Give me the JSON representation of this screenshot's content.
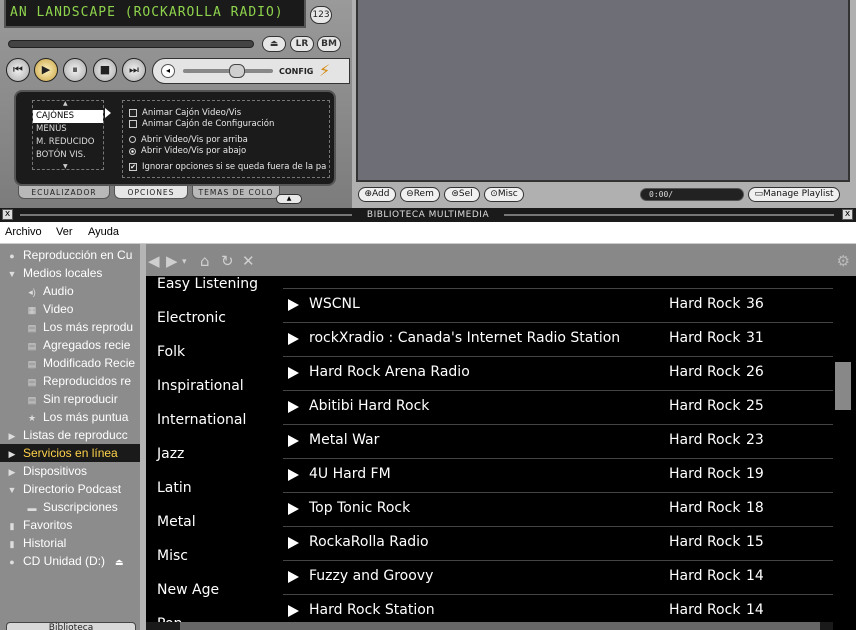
{
  "player": {
    "lcd_text": "AN LANDSCAPE (ROCKAROLLA RADIO)",
    "badge": "123",
    "shade_button": "⏏",
    "lr_button": "LR",
    "bm_button": "BM",
    "config_label": "CONFIG",
    "options": {
      "menu": [
        "CAJÓNES",
        "MENÚS",
        "M. REDUCIDO",
        "BOTÓN VIS."
      ],
      "checkbox_anim_video": "Animar Cajón Video/Vis",
      "checkbox_anim_config": "Animar Cajón de Configuración",
      "radio_open_top": "Abrir Video/Vis por arriba",
      "radio_open_bottom": "Abrir Video/Vis por abajo",
      "checkbox_ignore": "Ignorar opciones si se queda fuera de la pa"
    },
    "tabs": {
      "equalizer": "ECUALIZADOR",
      "options": "OPCIONES",
      "themes": "TEMAS DE COLO"
    }
  },
  "playlist": {
    "add": "Add",
    "rem": "Rem",
    "sel": "Sel",
    "misc": "Misc",
    "time": "0:00/",
    "manage": "Manage Playlist"
  },
  "library": {
    "title": "BIBLIOTECA MULTIMEDIA",
    "menu": {
      "archivo": "Archivo",
      "ver": "Ver",
      "ayuda": "Ayuda"
    },
    "tree": [
      {
        "label": "Reproducción en Cu",
        "icon": "●",
        "indent": 0,
        "selected": false
      },
      {
        "label": "Medios locales",
        "icon": "▼",
        "indent": 0,
        "selected": false
      },
      {
        "label": "Audio",
        "icon": "◂)",
        "indent": 1,
        "selected": false
      },
      {
        "label": "Video",
        "icon": "▦",
        "indent": 1,
        "selected": false
      },
      {
        "label": "Los más reprodu",
        "icon": "▤",
        "indent": 1,
        "selected": false
      },
      {
        "label": "Agregados recie",
        "icon": "▤",
        "indent": 1,
        "selected": false
      },
      {
        "label": "Modificado Recie",
        "icon": "▤",
        "indent": 1,
        "selected": false
      },
      {
        "label": "Reproducidos re",
        "icon": "▤",
        "indent": 1,
        "selected": false
      },
      {
        "label": "Sin reproducir",
        "icon": "▤",
        "indent": 1,
        "selected": false
      },
      {
        "label": "Los más puntua",
        "icon": "★",
        "indent": 1,
        "selected": false
      },
      {
        "label": "Listas de reproducc",
        "icon": "▶",
        "indent": 0,
        "selected": false
      },
      {
        "label": "Servicios en línea",
        "icon": "▶",
        "indent": 0,
        "selected": true
      },
      {
        "label": "Dispositivos",
        "icon": "▶",
        "indent": 0,
        "selected": false
      },
      {
        "label": "Directorio Podcast",
        "icon": "▼",
        "indent": 0,
        "selected": false
      },
      {
        "label": "Suscripciones",
        "icon": "▬",
        "indent": 1,
        "selected": false
      },
      {
        "label": "Favoritos",
        "icon": "▮",
        "indent": 0,
        "selected": false
      },
      {
        "label": "Historial",
        "icon": "▮",
        "indent": 0,
        "selected": false
      },
      {
        "label": "CD Unidad (D:)",
        "icon": "●",
        "indent": 0,
        "selected": false,
        "suffix": "⏏"
      }
    ],
    "tree_bottom_tab": "Biblioteca",
    "genres": [
      "Easy Listening",
      "Electronic",
      "Folk",
      "Inspirational",
      "International",
      "Jazz",
      "Latin",
      "Metal",
      "Misc",
      "New Age",
      "Pop"
    ],
    "stations": [
      {
        "name": "WSCNL",
        "genre": "Hard Rock",
        "count": "36"
      },
      {
        "name": "rockXradio : Canada's Internet Radio Station",
        "genre": "Hard Rock",
        "count": "31"
      },
      {
        "name": "Hard Rock Arena Radio",
        "genre": "Hard Rock",
        "count": "26"
      },
      {
        "name": "Abitibi Hard Rock",
        "genre": "Hard Rock",
        "count": "25"
      },
      {
        "name": "Metal War",
        "genre": "Hard Rock",
        "count": "23"
      },
      {
        "name": "4U Hard FM",
        "genre": "Hard Rock",
        "count": "19"
      },
      {
        "name": "Top Tonic Rock",
        "genre": "Hard Rock",
        "count": "18"
      },
      {
        "name": "RockaRolla Radio",
        "genre": "Hard Rock",
        "count": "15"
      },
      {
        "name": "Fuzzy and Groovy",
        "genre": "Hard Rock",
        "count": "14"
      },
      {
        "name": "Hard Rock Station",
        "genre": "Hard Rock",
        "count": "14"
      }
    ]
  }
}
